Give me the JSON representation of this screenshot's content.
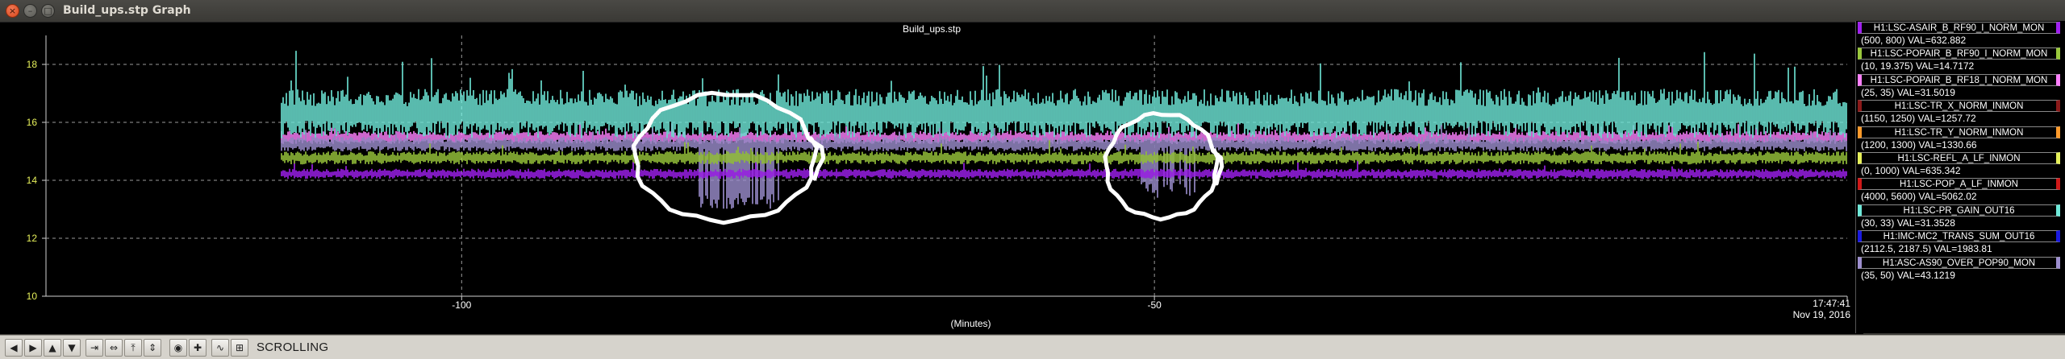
{
  "window": {
    "title": "Build_ups.stp Graph"
  },
  "plot": {
    "title": "Build_ups.stp",
    "time_label": "17:47:41",
    "date_label": "Nov 19, 2016",
    "x_unit_label": "(Minutes)"
  },
  "chart_data": {
    "type": "line",
    "title": "Build_ups.stp",
    "xlabel": "(Minutes)",
    "ylabel": "",
    "xlim": [
      -130,
      0
    ],
    "ylim": [
      10,
      19
    ],
    "x_ticks": [
      -100,
      -50
    ],
    "y_ticks": [
      10,
      12,
      14,
      16,
      18
    ],
    "grid": true,
    "data_start_x": -113,
    "series": [
      {
        "name": "H1:LSC-POPAIR_B_RF18_I_NORM_MON",
        "color": "#ff80ff",
        "y_band": [
          15.25,
          15.7
        ]
      },
      {
        "name": "H1:LSC-PR_GAIN_OUT16",
        "color": "#6fe9d9",
        "y_band": [
          15.45,
          17.15
        ]
      },
      {
        "name": "H1:ASC-AS90_OVER_POP90_MON",
        "color": "#9d8fcf",
        "y_band": [
          15.0,
          15.5
        ]
      },
      {
        "name": "H1:LSC-POPAIR_B_RF90_I_NORM_MON",
        "color": "#9ac83c",
        "y_band": [
          14.55,
          15.0
        ]
      },
      {
        "name": "H1:LSC-ASAIR_B_RF90_I_NORM_MON",
        "color": "#a020f0",
        "y_band": [
          14.05,
          14.4
        ]
      }
    ],
    "dips": [
      {
        "x_center": -80,
        "x_width": 6,
        "y_min": 13.0,
        "series": "H1:ASC-AS90_OVER_POP90_MON"
      },
      {
        "x_center": -49,
        "x_width": 4,
        "y_min": 13.4,
        "series": "H1:ASC-AS90_OVER_POP90_MON"
      }
    ],
    "annotations": [
      {
        "shape": "hand-drawn-circle",
        "x_center": -81,
        "y_center": 14.8,
        "x_radius": 6.5,
        "y_radius": 2.2
      },
      {
        "shape": "hand-drawn-circle",
        "x_center": -49.5,
        "y_center": 14.5,
        "x_radius": 4,
        "y_radius": 1.8
      }
    ]
  },
  "legend": {
    "items": [
      {
        "name": "H1:LSC-ASAIR_B_RF90_I_NORM_MON",
        "range": "(500, 800) VAL=632.882",
        "color": "#a020f0"
      },
      {
        "name": "H1:LSC-POPAIR_B_RF90_I_NORM_MON",
        "range": "(10, 19.375) VAL=14.7172",
        "color": "#9ac83c"
      },
      {
        "name": "H1:LSC-POPAIR_B_RF18_I_NORM_MON",
        "range": "(25, 35) VAL=31.5019",
        "color": "#ff80ff"
      },
      {
        "name": "H1:LSC-TR_X_NORM_INMON",
        "range": "(1150, 1250) VAL=1257.72",
        "color": "#8b1a1a"
      },
      {
        "name": "H1:LSC-TR_Y_NORM_INMON",
        "range": "(1200, 1300) VAL=1330.66",
        "color": "#ff9a2a"
      },
      {
        "name": "H1:LSC-REFL_A_LF_INMON",
        "range": "(0, 1000) VAL=635.342",
        "color": "#e6f05a"
      },
      {
        "name": "H1:LSC-POP_A_LF_INMON",
        "range": "(4000, 5600) VAL=5062.02",
        "color": "#d01818"
      },
      {
        "name": "H1:LSC-PR_GAIN_OUT16",
        "range": "(30, 33) VAL=31.3528",
        "color": "#6fe9d9"
      },
      {
        "name": "H1:IMC-MC2_TRANS_SUM_OUT16",
        "range": "(2112.5, 2187.5) VAL=1983.81",
        "color": "#1a1ae0"
      },
      {
        "name": "H1:ASC-AS90_OVER_POP90_MON",
        "range": "(35, 50) VAL=43.1219",
        "color": "#9d8fcf"
      }
    ]
  },
  "toolbar": {
    "mode_label": "SCROLLING",
    "buttons": [
      {
        "name": "scroll-left-button",
        "icon": "arrow-left-icon",
        "glyph": "◀"
      },
      {
        "name": "scroll-right-button",
        "icon": "arrow-right-icon",
        "glyph": "▶"
      },
      {
        "name": "scroll-up-button",
        "icon": "arrow-up-icon",
        "glyph": "▲"
      },
      {
        "name": "scroll-down-button",
        "icon": "arrow-down-icon",
        "glyph": "▼"
      },
      {
        "name": "compress-x-button",
        "icon": "compress-horizontal-icon",
        "glyph": "⇥"
      },
      {
        "name": "expand-x-button",
        "icon": "expand-horizontal-icon",
        "glyph": "⇔"
      },
      {
        "name": "compress-y-button",
        "icon": "compress-vertical-icon",
        "glyph": "⤒"
      },
      {
        "name": "expand-y-button",
        "icon": "expand-vertical-icon",
        "glyph": "⇕"
      },
      {
        "name": "record-button",
        "icon": "record-icon",
        "glyph": "◉"
      },
      {
        "name": "add-button",
        "icon": "plus-icon",
        "glyph": "✚"
      },
      {
        "name": "waveform-button",
        "icon": "waveform-icon",
        "glyph": "∿"
      },
      {
        "name": "split-button",
        "icon": "split-icon",
        "glyph": "⊞"
      }
    ]
  }
}
